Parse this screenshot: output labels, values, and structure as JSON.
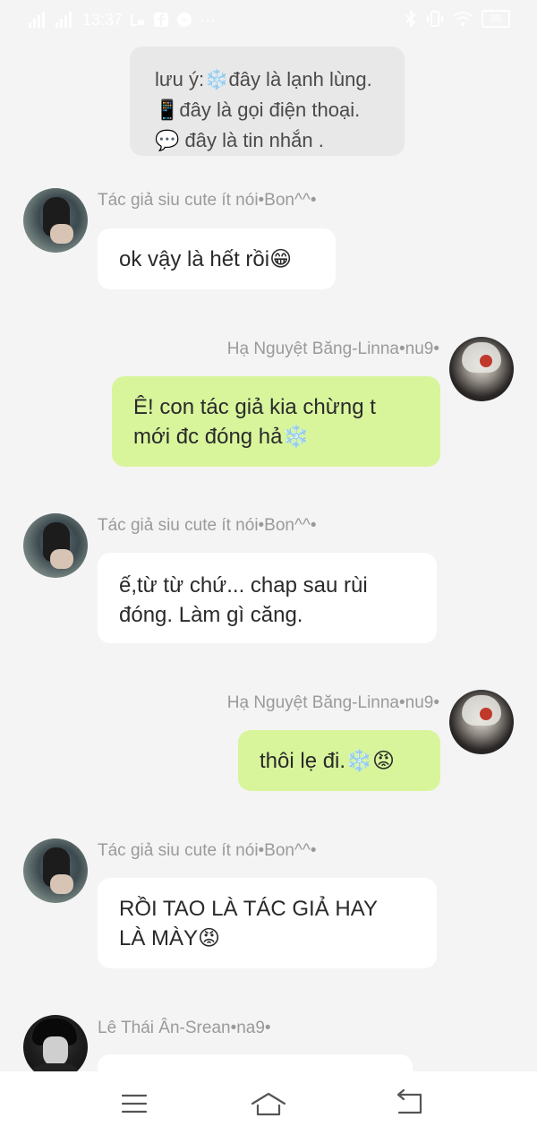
{
  "status_bar": {
    "time": "13:37",
    "left_icons": [
      "signal-icon",
      "signal-icon",
      "messenger-icon",
      "facebook-icon",
      "messenger-icon",
      "more-icon"
    ],
    "right_icons": [
      "bluetooth-icon",
      "vibrate-icon",
      "wifi-icon",
      "battery-icon"
    ],
    "more_glyph": "···",
    "battery_level": "88"
  },
  "note": {
    "line1": "lưu ý:❄️đây là lạnh lùng.",
    "line2": "📱đây là gọi điện thoại.",
    "line3": "💬 đây là tin nhắn ."
  },
  "messages": [
    {
      "sender": "Tác giả siu cute ít nói•Bon^^•",
      "side": "left",
      "lines": [
        "ok vậy là hết rồi😁"
      ]
    },
    {
      "sender": "Hạ Nguyệt Băng-Linna•nu9•",
      "side": "right",
      "lines": [
        "Ê! con tác giả kia chừng t",
        "mới đc đóng hả❄️"
      ]
    },
    {
      "sender": "Tác giả siu cute ít nói•Bon^^•",
      "side": "left",
      "lines": [
        "ế,từ từ chứ... chap sau rùi",
        "đóng. Làm gì căng."
      ]
    },
    {
      "sender": "Hạ Nguyệt Băng-Linna•nu9•",
      "side": "right",
      "lines": [
        "thôi lẹ đi.❄️😡"
      ]
    },
    {
      "sender": "Tác giả siu cute ít nói•Bon^^•",
      "side": "left",
      "lines": [
        "RỒI TAO LÀ TÁC GIẢ HAY",
        "LÀ MÀY😡"
      ]
    },
    {
      "sender": "Lê Thái Ân-Srean•na9•",
      "side": "left",
      "lines": []
    }
  ],
  "nav": {
    "items": [
      "menu-icon",
      "home-icon",
      "back-icon"
    ]
  },
  "colors": {
    "background": "#f4f4f4",
    "incoming_bubble": "#ffffff",
    "outgoing_bubble": "#d8f59c",
    "sender_text": "#9a9a9a"
  }
}
